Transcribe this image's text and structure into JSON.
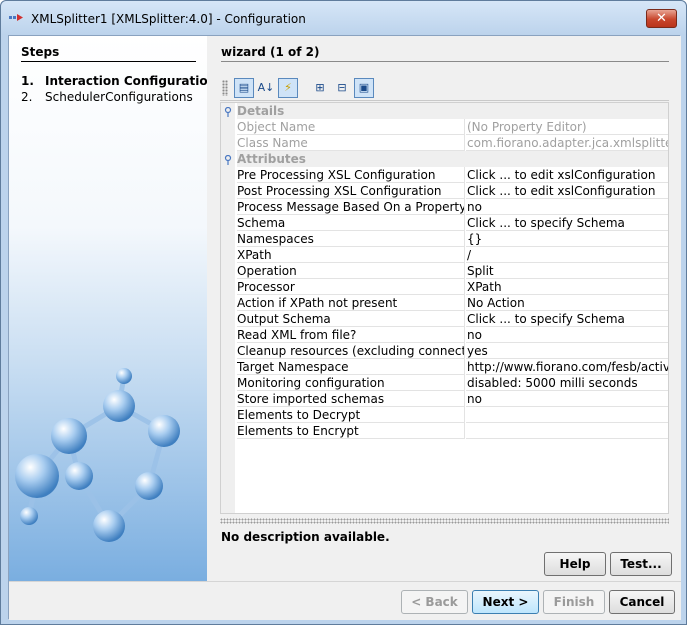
{
  "window": {
    "title": "XMLSplitter1 [XMLSplitter:4.0] - Configuration",
    "close_glyph": "✕"
  },
  "steps": {
    "title": "Steps",
    "items": [
      {
        "num": "1.",
        "label": "Interaction Configurations",
        "active": true
      },
      {
        "num": "2.",
        "label": "SchedulerConfigurations",
        "active": false
      }
    ]
  },
  "wizard": {
    "title": "wizard (1 of 2)",
    "toolbar": [
      {
        "name": "categorized-view-icon",
        "glyph": "▤",
        "pressed": true
      },
      {
        "name": "sort-alphabetical-icon",
        "glyph": "A↓",
        "pressed": false
      },
      {
        "name": "lightning-icon",
        "glyph": "⚡",
        "pressed": true
      },
      {
        "name": "expand-all-icon",
        "glyph": "⊞",
        "pressed": false
      },
      {
        "name": "collapse-all-icon",
        "glyph": "⊟",
        "pressed": false
      },
      {
        "name": "description-icon",
        "glyph": "▣",
        "pressed": true
      }
    ]
  },
  "properties": {
    "categories": {
      "details": "Details",
      "attributes": "Attributes"
    },
    "details": [
      {
        "key": "Object Name",
        "value": "(No Property Editor)"
      },
      {
        "key": "Class Name",
        "value": "com.fiorano.adapter.jca.xmlsplitter...."
      }
    ],
    "attributes": [
      {
        "key": "Pre Processing XSL Configuration",
        "value": "Click ... to edit xslConfiguration"
      },
      {
        "key": "Post Processing XSL Configuration",
        "value": "Click ... to edit xslConfiguration"
      },
      {
        "key": "Process Message Based On a Property",
        "value": "no"
      },
      {
        "key": "Schema",
        "value": "Click ... to specify Schema"
      },
      {
        "key": "Namespaces",
        "value": "{}"
      },
      {
        "key": "XPath",
        "value": "/"
      },
      {
        "key": "Operation",
        "value": "Split"
      },
      {
        "key": "Processor",
        "value": "XPath"
      },
      {
        "key": "Action if XPath not present",
        "value": "No Action"
      },
      {
        "key": "Output Schema",
        "value": "Click ... to specify Schema"
      },
      {
        "key": "Read XML from file?",
        "value": "no"
      },
      {
        "key": "Cleanup resources (excluding connecti...",
        "value": "yes"
      },
      {
        "key": "Target Namespace",
        "value": "http://www.fiorano.com/fesb/activity/..."
      },
      {
        "key": "Monitoring configuration",
        "value": "disabled: 5000 milli seconds"
      },
      {
        "key": "Store imported schemas",
        "value": "no"
      },
      {
        "key": "Elements to Decrypt",
        "value": ""
      },
      {
        "key": "Elements to Encrypt",
        "value": ""
      }
    ]
  },
  "description": "No description available.",
  "panel_buttons": {
    "help": "Help",
    "test": "Test..."
  },
  "footer_buttons": {
    "back": "< Back",
    "next": "Next >",
    "finish": "Finish",
    "cancel": "Cancel"
  },
  "colors": {
    "titlebar": "#bcd3ec",
    "accent_blue": "#3c7fb1",
    "close_red": "#c8462c"
  }
}
